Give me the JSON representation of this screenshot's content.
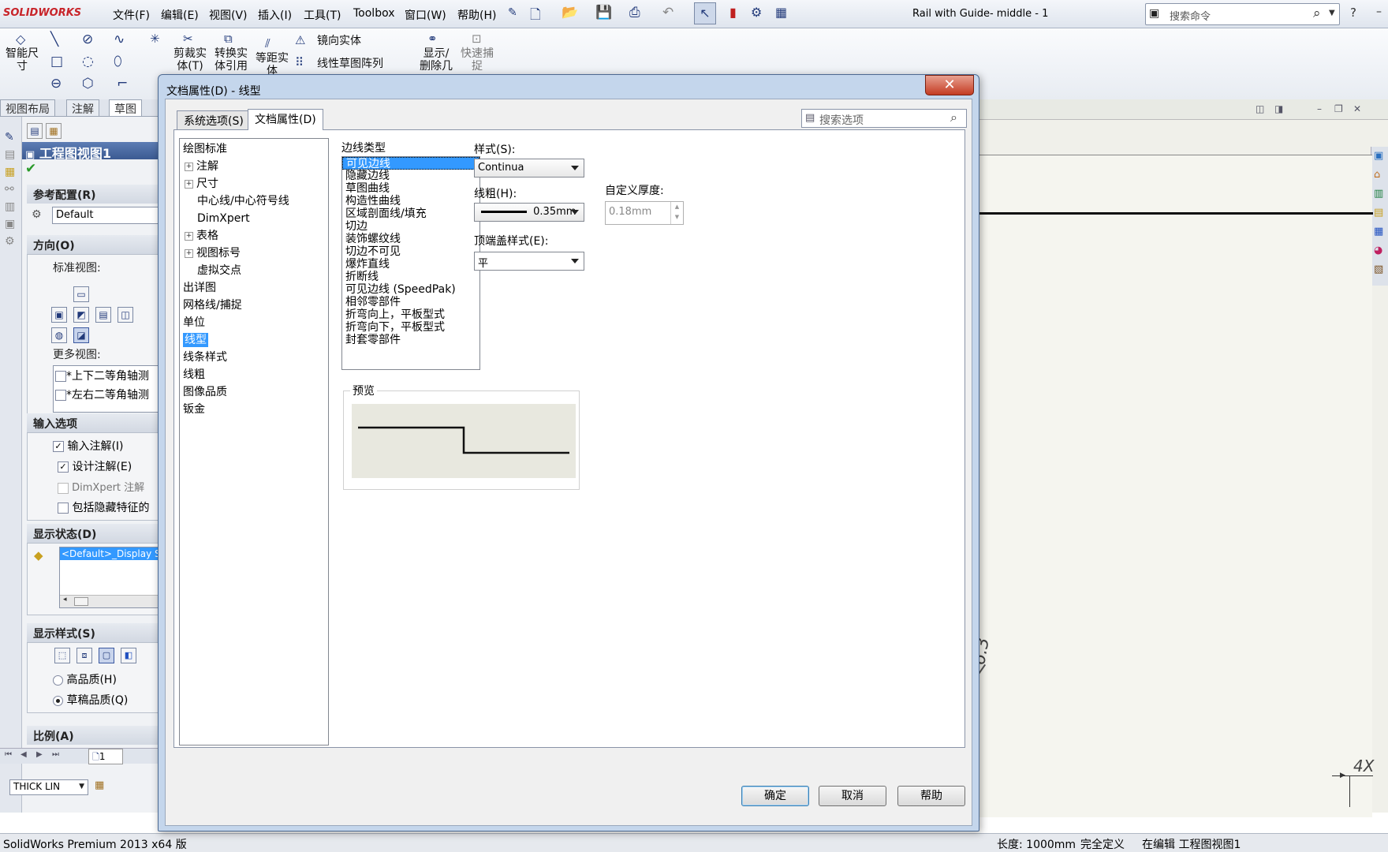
{
  "app": {
    "logo": "SOLIDWORKS",
    "menus": [
      "文件(F)",
      "编辑(E)",
      "视图(V)",
      "插入(I)",
      "工具(T)",
      "Toolbox",
      "窗口(W)",
      "帮助(H)"
    ],
    "doc_title": "Rail with Guide- middle - 1",
    "cmd_search_placeholder": "搜索命令"
  },
  "ribbon": {
    "smart_dim": [
      "智能尺",
      "寸"
    ],
    "trim": [
      "剪裁实",
      "体(T)"
    ],
    "convert": [
      "转换实",
      "体引用"
    ],
    "offset": [
      "等距实",
      "体"
    ],
    "mirror": "镜向实体",
    "linear_pattern": "线性草图阵列",
    "show_delete": [
      "显示/",
      "删除几"
    ],
    "quick_snap": [
      "快速捕",
      "捉"
    ],
    "tabs": [
      "视图布局",
      "注解",
      "草图"
    ]
  },
  "property_manager": {
    "title": "工程图视图1",
    "ref_config_head": "参考配置(R)",
    "ref_config_value": "Default",
    "orientation_head": "方向(O)",
    "std_views_label": "标准视图:",
    "more_views_label": "更多视图:",
    "more_views": [
      "*上下二等角轴测",
      "*左右二等角轴测"
    ],
    "import_head": "输入选项",
    "import_items": [
      {
        "label": "输入注解(I)",
        "checked": true
      },
      {
        "label": "设计注解(E)",
        "checked": true
      },
      {
        "label": "DimXpert 注解",
        "checked": false
      },
      {
        "label": "包括隐藏特征的",
        "checked": false
      }
    ],
    "display_state_head": "显示状态(D)",
    "display_state_value": "<Default>_Display St",
    "display_style_head": "显示样式(S)",
    "quality_options": [
      {
        "label": "高品质(H)",
        "selected": false
      },
      {
        "label": "草稿品质(Q)",
        "selected": true
      }
    ],
    "scale_head": "比例(A)",
    "layer_value": "THICK LIN",
    "sheet_tab": "1"
  },
  "dialog": {
    "title": "文档属性(D) - 线型",
    "close_label": "✕",
    "tabs": [
      "系统选项(S)",
      "文档属性(D)"
    ],
    "active_tab": 1,
    "search_placeholder": "搜索选项",
    "tree": [
      {
        "label": "绘图标准",
        "level": 0,
        "expandable": false
      },
      {
        "label": "注解",
        "level": 1,
        "expandable": true
      },
      {
        "label": "尺寸",
        "level": 1,
        "expandable": true
      },
      {
        "label": "中心线/中心符号线",
        "level": 2,
        "expandable": false
      },
      {
        "label": "DimXpert",
        "level": 2,
        "expandable": false
      },
      {
        "label": "表格",
        "level": 1,
        "expandable": true
      },
      {
        "label": "视图标号",
        "level": 1,
        "expandable": true
      },
      {
        "label": "虚拟交点",
        "level": 2,
        "expandable": false
      },
      {
        "label": "出详图",
        "level": 0,
        "expandable": false
      },
      {
        "label": "网格线/捕捉",
        "level": 0,
        "expandable": false
      },
      {
        "label": "单位",
        "level": 0,
        "expandable": false
      },
      {
        "label": "线型",
        "level": 0,
        "expandable": false,
        "selected": true
      },
      {
        "label": "线条样式",
        "level": 0,
        "expandable": false
      },
      {
        "label": "线粗",
        "level": 0,
        "expandable": false
      },
      {
        "label": "图像品质",
        "level": 0,
        "expandable": false
      },
      {
        "label": "钣金",
        "level": 0,
        "expandable": false
      }
    ],
    "edge_type_label": "边线类型",
    "edge_types": [
      "可见边线",
      "隐藏边线",
      "草图曲线",
      "构造性曲线",
      "区域剖面线/填充",
      "切边",
      "装饰螺纹线",
      "切边不可见",
      "爆炸直线",
      "折断线",
      "可见边线 (SpeedPak)",
      "相邻零部件",
      "折弯向上，平板型式",
      "折弯向下，平板型式",
      "封套零部件"
    ],
    "edge_selected": 0,
    "style_label": "样式(S):",
    "style_value": "Continua",
    "thickness_label": "线粗(H):",
    "thickness_value": "0.35mm",
    "custom_thickness_label": "自定义厚度:",
    "custom_thickness_value": "0.18mm",
    "end_cap_label": "顶端盖样式(E):",
    "end_cap_value": "平",
    "preview_label": "预览",
    "buttons": {
      "ok": "确定",
      "cancel": "取消",
      "help": "帮助"
    }
  },
  "graphics": {
    "note_value": "6.3",
    "dim_text": "4X"
  },
  "status": {
    "product": "SolidWorks Premium 2013 x64 版",
    "length": "长度: 1000mm",
    "definition": "完全定义",
    "editing": "在编辑 工程图视图1"
  },
  "colors": {
    "accent_selection": "#3399ff",
    "dialog_frame": "#c4d6ec",
    "close_button": "#c43b22",
    "preview_bg": "#e8e8df"
  }
}
